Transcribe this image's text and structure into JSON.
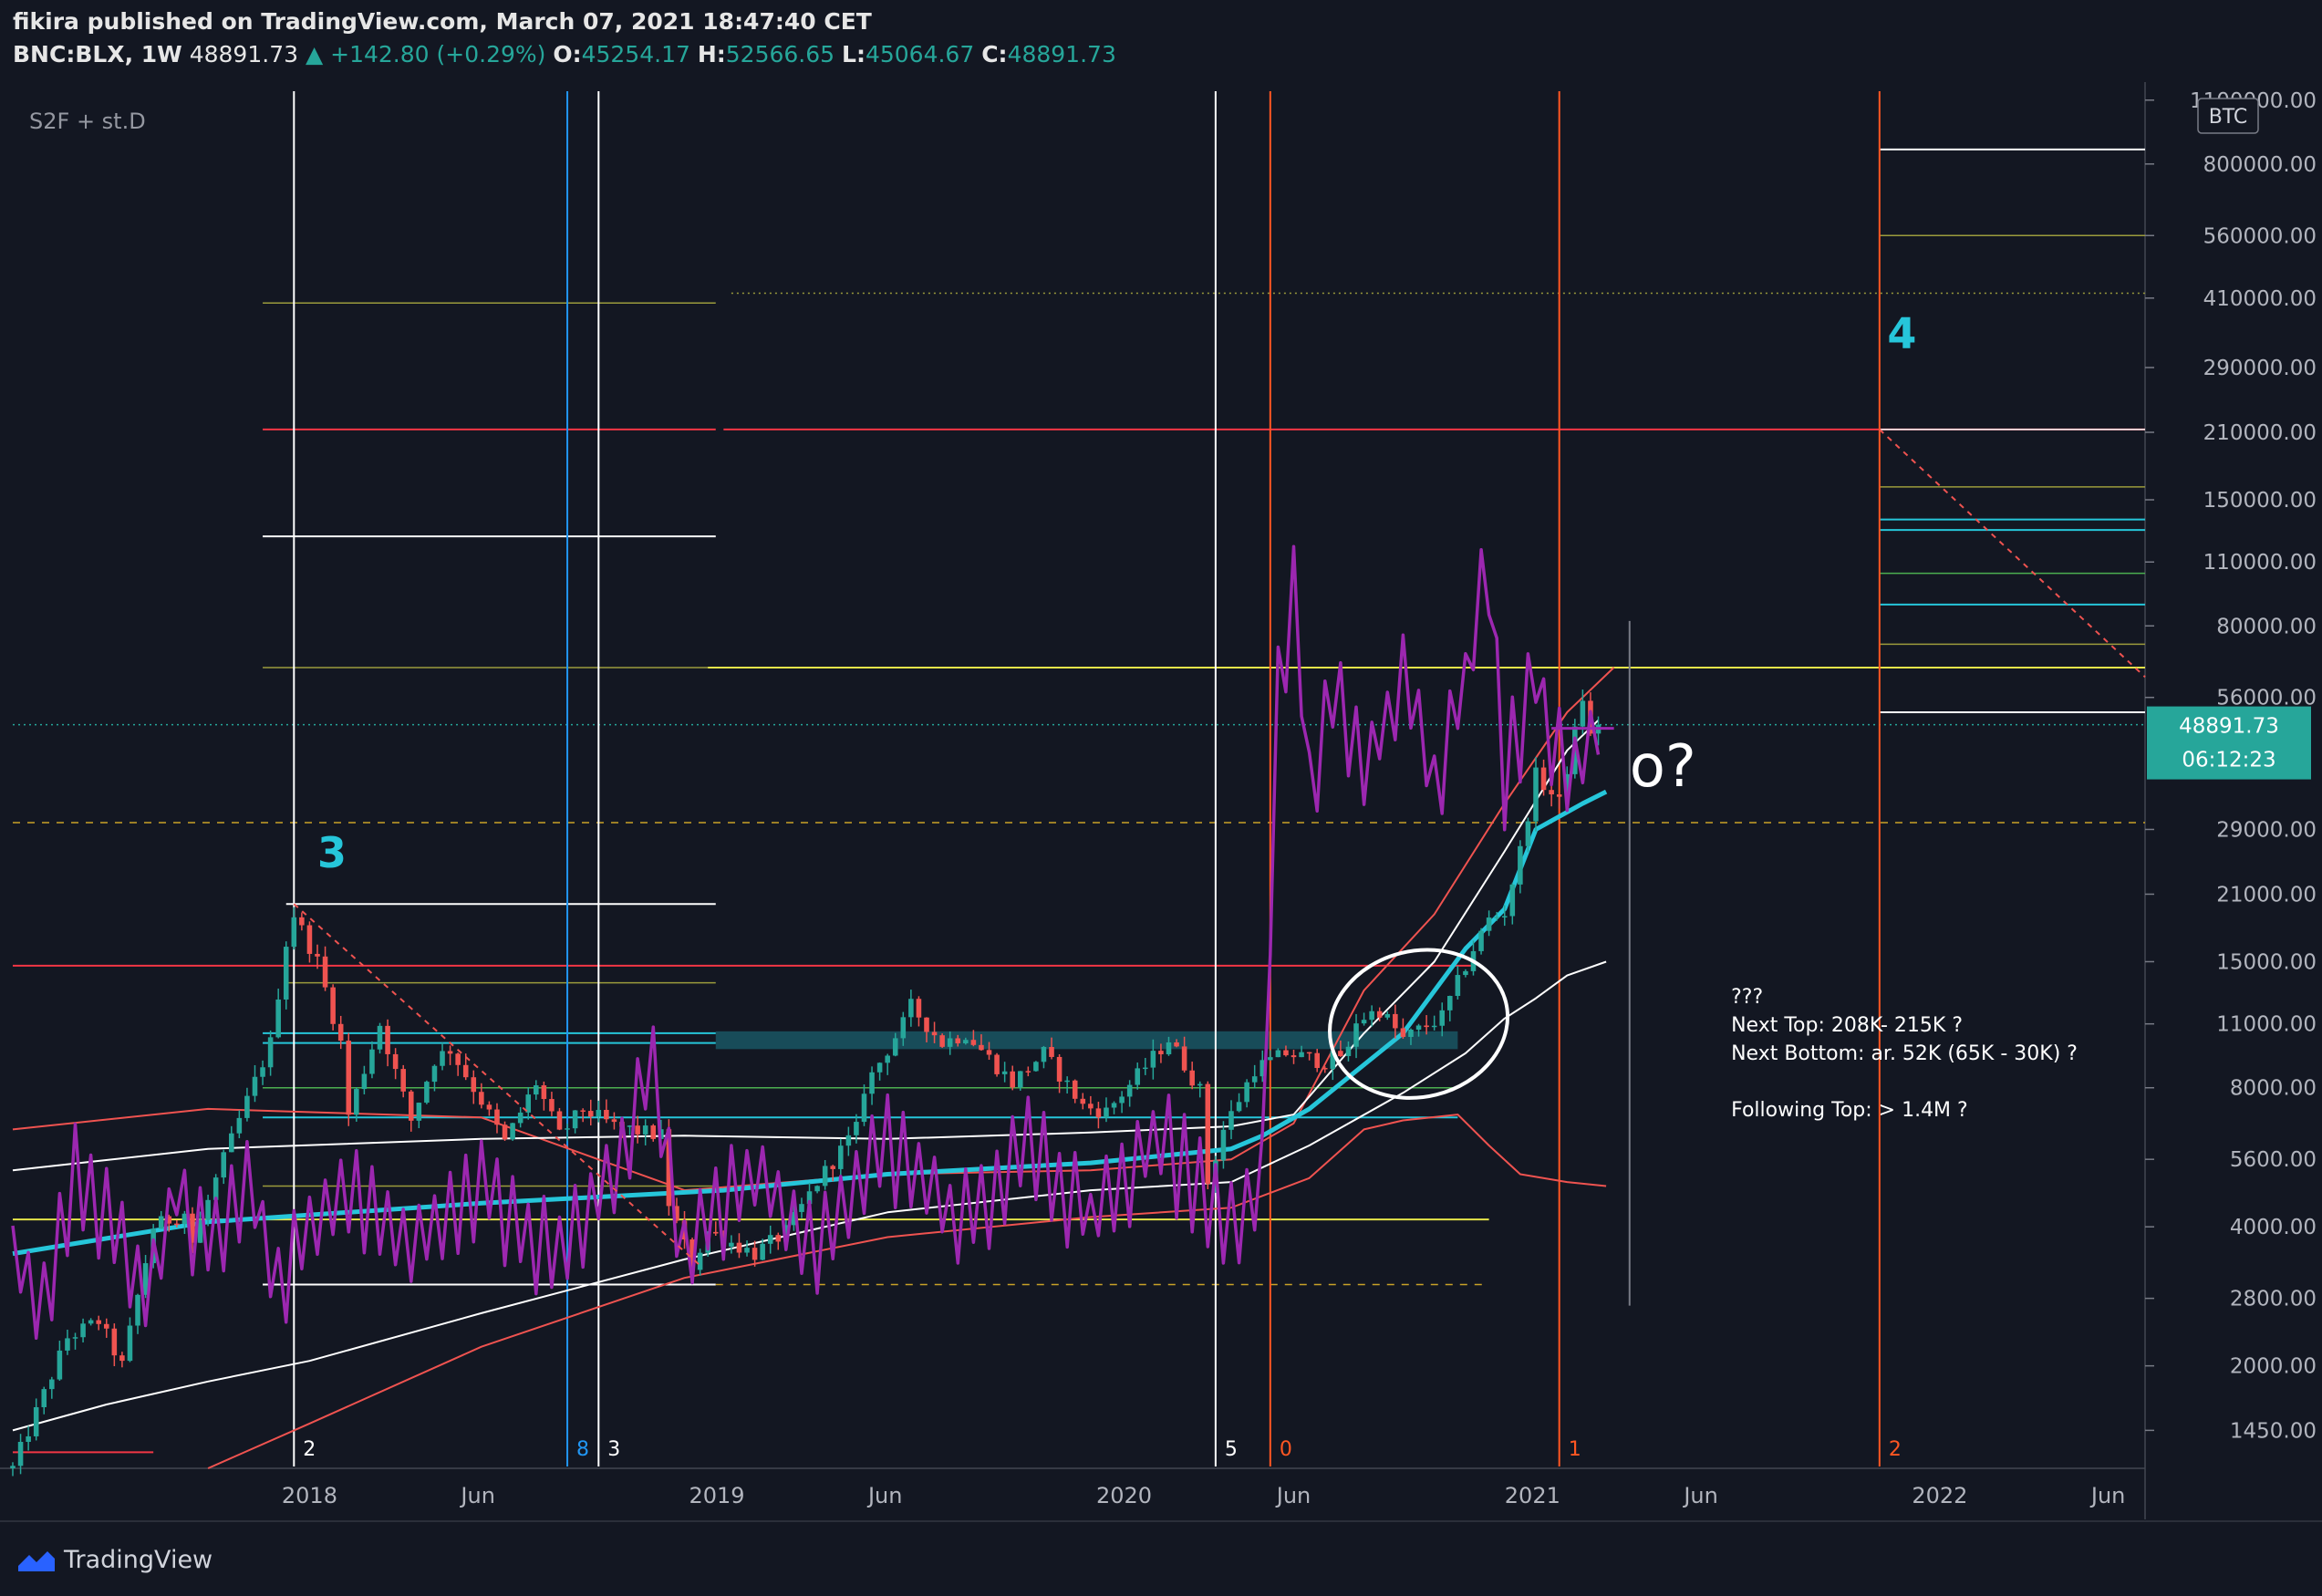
{
  "header": {
    "publisher_line": "fikira published on TradingView.com, March 07, 2021 18:47:40 CET",
    "symbol": "BNC:BLX, 1W",
    "last": "48891.73",
    "change": "▲ +142.80 (+0.29%)",
    "o_label": "O:",
    "o": "45254.17",
    "h_label": "H:",
    "h": "52566.65",
    "l_label": "L:",
    "l": "45064.67",
    "c_label": "C:",
    "c": "48891.73"
  },
  "indicator_label": "S2F + st.D",
  "currency_label": "BTC",
  "footer": {
    "brand": "TradingView",
    "logo_icon": "tradingview-logo-icon"
  },
  "colors": {
    "background": "#131722",
    "up": "#26a69a",
    "down": "#ef5350",
    "purple": "#9c27b0",
    "cyan": "#26c6da",
    "red_line": "#f23645",
    "yellow": "#e6e64a",
    "olive": "#9b9b3c",
    "white": "#ffffff",
    "blue": "#2962ff",
    "vline_red": "#ff5722"
  },
  "chart_data": {
    "type": "line",
    "scale": "log",
    "ylim": [
      1200,
      1150000
    ],
    "xlim": [
      "2017-04-10",
      "2022-07-04"
    ],
    "x_ticks": [
      {
        "label": "2018",
        "date": "2018-01-01"
      },
      {
        "label": "Jun",
        "date": "2018-06-01"
      },
      {
        "label": "2019",
        "date": "2019-01-01"
      },
      {
        "label": "Jun",
        "date": "2019-06-01"
      },
      {
        "label": "2020",
        "date": "2020-01-01"
      },
      {
        "label": "Jun",
        "date": "2020-06-01"
      },
      {
        "label": "2021",
        "date": "2021-01-01"
      },
      {
        "label": "Jun",
        "date": "2021-06-01"
      },
      {
        "label": "2022",
        "date": "2022-01-01"
      },
      {
        "label": "Jun",
        "date": "2022-06-01"
      }
    ],
    "y_ticks": [
      {
        "label": "1100000.00",
        "value": 1100000
      },
      {
        "label": "800000.00",
        "value": 800000
      },
      {
        "label": "560000.00",
        "value": 560000
      },
      {
        "label": "410000.00",
        "value": 410000
      },
      {
        "label": "290000.00",
        "value": 290000
      },
      {
        "label": "210000.00",
        "value": 210000
      },
      {
        "label": "150000.00",
        "value": 150000
      },
      {
        "label": "110000.00",
        "value": 110000
      },
      {
        "label": "80000.00",
        "value": 80000
      },
      {
        "label": "56000.00",
        "value": 56000
      },
      {
        "label": "29000.00",
        "value": 29000
      },
      {
        "label": "21000.00",
        "value": 21000
      },
      {
        "label": "15000.00",
        "value": 15000
      },
      {
        "label": "11000.00",
        "value": 11000
      },
      {
        "label": "8000.00",
        "value": 8000
      },
      {
        "label": "5600.00",
        "value": 5600
      },
      {
        "label": "4000.00",
        "value": 4000
      },
      {
        "label": "2800.00",
        "value": 2800
      },
      {
        "label": "2000.00",
        "value": 2000
      },
      {
        "label": "1450.00",
        "value": 1450
      }
    ],
    "price_tag": {
      "value": 48891.73,
      "label": "48891.73",
      "countdown": "06:12:23"
    },
    "price_anchors": [
      [
        "2017-04-10",
        1200
      ],
      [
        "2017-05-29",
        2300
      ],
      [
        "2017-06-26",
        2500
      ],
      [
        "2017-07-17",
        2000
      ],
      [
        "2017-08-14",
        4000
      ],
      [
        "2017-09-11",
        4300
      ],
      [
        "2017-09-18",
        3700
      ],
      [
        "2017-10-16",
        5600
      ],
      [
        "2017-11-06",
        7500
      ],
      [
        "2017-11-27",
        10000
      ],
      [
        "2017-12-11",
        16500
      ],
      [
        "2017-12-18",
        19000
      ],
      [
        "2018-01-08",
        15000
      ],
      [
        "2018-01-29",
        10000
      ],
      [
        "2018-02-05",
        7000
      ],
      [
        "2018-03-05",
        11000
      ],
      [
        "2018-04-02",
        6800
      ],
      [
        "2018-04-23",
        9200
      ],
      [
        "2018-05-07",
        9700
      ],
      [
        "2018-06-04",
        7500
      ],
      [
        "2018-06-25",
        6100
      ],
      [
        "2018-07-23",
        8200
      ],
      [
        "2018-08-13",
        6300
      ],
      [
        "2018-09-03",
        7200
      ],
      [
        "2018-10-01",
        6600
      ],
      [
        "2018-11-12",
        6300
      ],
      [
        "2018-11-19",
        4500
      ],
      [
        "2018-12-10",
        3300
      ],
      [
        "2018-12-24",
        3900
      ],
      [
        "2019-02-04",
        3500
      ],
      [
        "2019-03-04",
        3900
      ],
      [
        "2019-04-01",
        5000
      ],
      [
        "2019-05-06",
        6500
      ],
      [
        "2019-05-13",
        8000
      ],
      [
        "2019-06-17",
        11000
      ],
      [
        "2019-06-24",
        12000
      ],
      [
        "2019-07-22",
        10000
      ],
      [
        "2019-08-12",
        10500
      ],
      [
        "2019-09-23",
        8200
      ],
      [
        "2019-10-21",
        9500
      ],
      [
        "2019-11-25",
        7300
      ],
      [
        "2019-12-16",
        7100
      ],
      [
        "2020-01-13",
        8500
      ],
      [
        "2020-02-10",
        10200
      ],
      [
        "2020-03-09",
        7900
      ],
      [
        "2020-03-16",
        5000
      ],
      [
        "2020-03-30",
        6500
      ],
      [
        "2020-04-27",
        8800
      ],
      [
        "2020-05-25",
        9500
      ],
      [
        "2020-06-29",
        9100
      ],
      [
        "2020-07-20",
        9600
      ],
      [
        "2020-07-27",
        11200
      ],
      [
        "2020-08-17",
        11800
      ],
      [
        "2020-09-07",
        10200
      ],
      [
        "2020-10-12",
        11400
      ],
      [
        "2020-10-26",
        13500
      ],
      [
        "2020-11-09",
        16000
      ],
      [
        "2020-11-23",
        18500
      ],
      [
        "2020-12-07",
        19200
      ],
      [
        "2020-12-21",
        26000
      ],
      [
        "2021-01-04",
        38000
      ],
      [
        "2021-01-25",
        33000
      ],
      [
        "2021-02-08",
        47000
      ],
      [
        "2021-02-15",
        56000
      ],
      [
        "2021-02-22",
        46000
      ],
      [
        "2021-03-01",
        48891.73
      ]
    ],
    "s2f_anchors": [
      [
        "2017-04-10",
        3500
      ],
      [
        "2017-05-08",
        2800
      ],
      [
        "2017-06-05",
        5500
      ],
      [
        "2017-07-03",
        4200
      ],
      [
        "2017-08-07",
        2800
      ],
      [
        "2017-09-04",
        5000
      ],
      [
        "2017-10-02",
        3600
      ],
      [
        "2017-11-06",
        5200
      ],
      [
        "2017-12-04",
        3200
      ],
      [
        "2018-02-05",
        4900
      ],
      [
        "2018-04-02",
        3700
      ],
      [
        "2018-06-04",
        5100
      ],
      [
        "2018-08-06",
        3600
      ],
      [
        "2018-10-01",
        5300
      ],
      [
        "2018-11-05",
        9000
      ],
      [
        "2018-12-03",
        3500
      ],
      [
        "2019-02-04",
        5500
      ],
      [
        "2019-04-01",
        3700
      ],
      [
        "2019-06-03",
        6200
      ],
      [
        "2019-08-05",
        4000
      ],
      [
        "2019-10-07",
        6500
      ],
      [
        "2019-12-02",
        4200
      ],
      [
        "2020-02-03",
        6300
      ],
      [
        "2020-04-06",
        4200
      ],
      [
        "2020-05-04",
        5500
      ],
      [
        "2020-05-18",
        60000
      ],
      [
        "2020-06-01",
        95000
      ],
      [
        "2020-06-15",
        36000
      ],
      [
        "2020-07-06",
        60000
      ],
      [
        "2020-08-03",
        40000
      ],
      [
        "2020-09-07",
        62000
      ],
      [
        "2020-10-05",
        38000
      ],
      [
        "2020-11-02",
        60000
      ],
      [
        "2020-11-23",
        115000
      ],
      [
        "2020-12-07",
        40000
      ],
      [
        "2021-01-04",
        62000
      ],
      [
        "2021-02-01",
        38000
      ],
      [
        "2021-03-01",
        48000
      ]
    ],
    "s2f_cross": {
      "value": 48000,
      "from": "2021-01-18",
      "to": "2021-03-15"
    },
    "ma_cyan": [
      [
        "2017-04-10",
        3500
      ],
      [
        "2017-10-02",
        4100
      ],
      [
        "2018-06-04",
        4500
      ],
      [
        "2019-01-07",
        4800
      ],
      [
        "2019-06-03",
        5200
      ],
      [
        "2019-12-02",
        5500
      ],
      [
        "2020-04-06",
        5900
      ],
      [
        "2020-05-04",
        6300
      ],
      [
        "2020-06-15",
        7200
      ],
      [
        "2020-09-07",
        10500
      ],
      [
        "2020-11-02",
        16000
      ],
      [
        "2020-12-07",
        19500
      ],
      [
        "2021-01-04",
        29000
      ],
      [
        "2021-02-15",
        33000
      ],
      [
        "2021-03-08",
        35000
      ]
    ],
    "ma_white_thin": [
      [
        "2017-04-10",
        5300
      ],
      [
        "2017-10-02",
        5900
      ],
      [
        "2018-06-04",
        6200
      ],
      [
        "2018-12-03",
        6300
      ],
      [
        "2019-06-03",
        6200
      ],
      [
        "2019-12-02",
        6400
      ],
      [
        "2020-04-06",
        6600
      ],
      [
        "2020-06-01",
        7000
      ],
      [
        "2020-08-03",
        10500
      ],
      [
        "2020-10-05",
        15000
      ],
      [
        "2020-12-07",
        26000
      ],
      [
        "2021-02-01",
        43000
      ],
      [
        "2021-03-01",
        50000
      ]
    ],
    "ma_red_upper": [
      [
        "2017-04-10",
        6500
      ],
      [
        "2017-10-02",
        7200
      ],
      [
        "2018-06-04",
        6900
      ],
      [
        "2018-12-03",
        4800
      ],
      [
        "2019-06-03",
        5200
      ],
      [
        "2019-12-02",
        5300
      ],
      [
        "2020-04-06",
        5600
      ],
      [
        "2020-06-01",
        6700
      ],
      [
        "2020-08-03",
        13000
      ],
      [
        "2020-10-05",
        19000
      ],
      [
        "2020-12-07",
        33000
      ],
      [
        "2021-02-01",
        52000
      ],
      [
        "2021-03-15",
        65000
      ]
    ],
    "ma_white_200": [
      [
        "2017-04-10",
        1450
      ],
      [
        "2017-07-03",
        1650
      ],
      [
        "2017-10-02",
        1850
      ],
      [
        "2018-01-01",
        2050
      ],
      [
        "2018-06-04",
        2600
      ],
      [
        "2018-12-03",
        3400
      ],
      [
        "2019-06-03",
        4300
      ],
      [
        "2019-12-02",
        4800
      ],
      [
        "2020-04-06",
        5000
      ],
      [
        "2020-06-15",
        6000
      ],
      [
        "2020-09-07",
        7800
      ],
      [
        "2020-11-02",
        9500
      ],
      [
        "2020-12-07",
        11300
      ],
      [
        "2021-01-04",
        12500
      ],
      [
        "2021-02-01",
        14000
      ],
      [
        "2021-03-08",
        15000
      ]
    ],
    "ma_red_lower": [
      [
        "2017-10-02",
        1200
      ],
      [
        "2018-01-01",
        1500
      ],
      [
        "2018-06-04",
        2200
      ],
      [
        "2018-12-03",
        3100
      ],
      [
        "2019-06-03",
        3800
      ],
      [
        "2019-12-02",
        4200
      ],
      [
        "2020-04-06",
        4400
      ],
      [
        "2020-06-15",
        5100
      ],
      [
        "2020-08-03",
        6500
      ],
      [
        "2020-09-07",
        6800
      ],
      [
        "2020-10-26",
        7000
      ],
      [
        "2020-11-23",
        6000
      ],
      [
        "2020-12-21",
        5200
      ],
      [
        "2021-02-01",
        5000
      ],
      [
        "2021-03-08",
        4900
      ]
    ],
    "hlines": [
      {
        "value": 860000,
        "from": "2021-11-08",
        "to": "2022-07-04",
        "color": "#ffffff",
        "width": 2
      },
      {
        "value": 560000,
        "from": "2021-11-08",
        "to": "2022-07-04",
        "color": "#9b9b3c",
        "width": 1.5
      },
      {
        "value": 420000,
        "from": "2019-01-14",
        "to": "2022-07-04",
        "color": "#9b9b3c",
        "width": 1.5,
        "dash": "2,4"
      },
      {
        "value": 400000,
        "from": "2017-11-20",
        "to": "2018-12-31",
        "color": "#9b9b3c",
        "width": 1.5
      },
      {
        "value": 213000,
        "from": "2017-11-20",
        "to": "2018-12-31",
        "color": "#f23645",
        "width": 2
      },
      {
        "value": 213000,
        "from": "2019-01-07",
        "to": "2022-07-04",
        "color": "#f23645",
        "width": 2
      },
      {
        "value": 213000,
        "from": "2021-11-08",
        "to": "2022-07-04",
        "color": "#ffffff",
        "width": 1.5
      },
      {
        "value": 160000,
        "from": "2021-11-08",
        "to": "2022-07-04",
        "color": "#9b9b3c",
        "width": 1.5
      },
      {
        "value": 125000,
        "from": "2017-11-20",
        "to": "2018-12-31",
        "color": "#ffffff",
        "width": 2
      },
      {
        "value": 136000,
        "from": "2021-11-08",
        "to": "2022-07-04",
        "color": "#26c6da",
        "width": 2
      },
      {
        "value": 129000,
        "from": "2021-11-08",
        "to": "2022-07-04",
        "color": "#26c6da",
        "width": 2
      },
      {
        "value": 104000,
        "from": "2021-11-08",
        "to": "2022-07-04",
        "color": "#4caf50",
        "width": 1.5
      },
      {
        "value": 89000,
        "from": "2021-11-08",
        "to": "2022-07-04",
        "color": "#26c6da",
        "width": 2
      },
      {
        "value": 73000,
        "from": "2021-11-08",
        "to": "2022-07-04",
        "color": "#9b9b3c",
        "width": 1.5
      },
      {
        "value": 65000,
        "from": "2017-11-20",
        "to": "2018-12-31",
        "color": "#9b9b3c",
        "width": 1.5
      },
      {
        "value": 65000,
        "from": "2018-12-24",
        "to": "2022-07-04",
        "color": "#e6e64a",
        "width": 2
      },
      {
        "value": 52000,
        "from": "2021-11-08",
        "to": "2022-07-04",
        "color": "#ffffff",
        "width": 2
      },
      {
        "value": 48891.73,
        "from": "2017-04-10",
        "to": "2022-07-04",
        "color": "#26a69a",
        "width": 1.5,
        "dash": "2,4"
      },
      {
        "value": 30000,
        "from": "2017-04-10",
        "to": "2022-07-04",
        "color": "#c9a227",
        "width": 1.5,
        "dash": "8,8"
      },
      {
        "value": 20000,
        "from": "2017-12-11",
        "to": "2018-12-31",
        "color": "#ffffff",
        "width": 2
      },
      {
        "value": 14700,
        "from": "2017-04-10",
        "to": "2020-11-09",
        "color": "#f23645",
        "width": 2
      },
      {
        "value": 13500,
        "from": "2017-12-11",
        "to": "2018-12-31",
        "color": "#9b9b3c",
        "width": 1.5
      },
      {
        "value": 10500,
        "from": "2017-11-20",
        "to": "2018-12-31",
        "color": "#26c6da",
        "width": 2
      },
      {
        "value": 10000,
        "from": "2017-11-20",
        "to": "2018-12-31",
        "color": "#26c6da",
        "width": 2
      },
      {
        "value": 8000,
        "from": "2017-11-20",
        "to": "2020-10-26",
        "color": "#4caf50",
        "width": 1.5
      },
      {
        "value": 6900,
        "from": "2017-11-20",
        "to": "2020-10-26",
        "color": "#26c6da",
        "width": 2
      },
      {
        "value": 4900,
        "from": "2017-11-20",
        "to": "2018-12-31",
        "color": "#9b9b3c",
        "width": 1.5
      },
      {
        "value": 4150,
        "from": "2017-04-10",
        "to": "2020-11-23",
        "color": "#e6e64a",
        "width": 2
      },
      {
        "value": 3000,
        "from": "2017-11-20",
        "to": "2018-12-31",
        "color": "#ffffff",
        "width": 2
      },
      {
        "value": 3000,
        "from": "2018-12-31",
        "to": "2020-11-23",
        "color": "#c9a227",
        "width": 1.5,
        "dash": "8,8"
      },
      {
        "value": 1300,
        "from": "2017-04-10",
        "to": "2017-08-14",
        "color": "#f23645",
        "width": 2
      }
    ],
    "band": {
      "top": 10600,
      "bottom": 9700,
      "from": "2018-12-31",
      "to": "2020-10-26",
      "color": "#26c6da"
    },
    "vlines": [
      {
        "date": "2017-12-18",
        "color": "#ffffff",
        "label": "2"
      },
      {
        "date": "2018-08-20",
        "color": "#2196f3",
        "label": "8"
      },
      {
        "date": "2018-09-17",
        "color": "#ffffff",
        "label": "3"
      },
      {
        "date": "2020-03-23",
        "color": "#ffffff",
        "label": "5"
      },
      {
        "date": "2020-05-11",
        "color": "#ff5722",
        "label": "0"
      },
      {
        "date": "2021-01-25",
        "color": "#ff5722",
        "label": "1"
      },
      {
        "date": "2021-11-08",
        "color": "#ff5722",
        "label": "2"
      },
      {
        "date": "2021-03-29",
        "color": "#787b86",
        "label": "",
        "from": 2700,
        "to": 82000
      }
    ],
    "diagonals": [
      {
        "from": [
          "2017-12-18",
          20000
        ],
        "to": [
          "2018-12-17",
          3300
        ],
        "color": "#ef5350"
      },
      {
        "from": [
          "2021-11-08",
          213000
        ],
        "to": [
          "2022-07-04",
          62000
        ],
        "color": "#ef5350"
      }
    ],
    "ellipse": {
      "center": [
        "2020-09-21",
        11000
      ],
      "rx_weeks": 11.5,
      "ry_top": 14700,
      "ry_bottom": 7100
    },
    "markers": [
      {
        "text": "3",
        "date": "2018-01-08",
        "value": 24000,
        "color": "#26c6da"
      },
      {
        "text": "4",
        "date": "2021-11-15",
        "value": 320000,
        "color": "#26c6da"
      },
      {
        "text": "o?",
        "date": "2021-03-29",
        "value": 36000,
        "color": "#ffffff"
      }
    ],
    "annotations": [
      "???",
      "Next Top: 208K- 215K ?",
      "Next Bottom: ar. 52K (65K - 30K) ?",
      "",
      "Following Top: > 1.4M ?"
    ],
    "annotation_anchor": {
      "date": "2021-06-28",
      "value": 12200
    }
  }
}
